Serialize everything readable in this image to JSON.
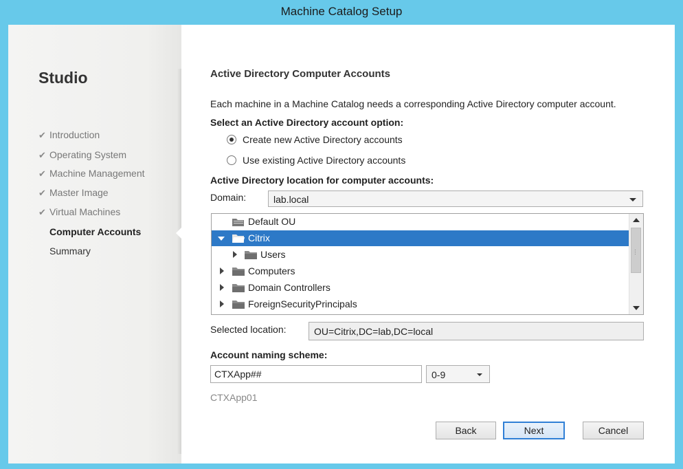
{
  "window": {
    "title": "Machine Catalog Setup"
  },
  "sidebar": {
    "app_name": "Studio",
    "steps": [
      {
        "label": "Introduction",
        "state": "done"
      },
      {
        "label": "Operating System",
        "state": "done"
      },
      {
        "label": "Machine Management",
        "state": "done"
      },
      {
        "label": "Master Image",
        "state": "done"
      },
      {
        "label": "Virtual Machines",
        "state": "done"
      },
      {
        "label": "Computer Accounts",
        "state": "current"
      },
      {
        "label": "Summary",
        "state": "pending"
      }
    ]
  },
  "main": {
    "heading": "Active Directory Computer Accounts",
    "intro": "Each machine in a Machine Catalog needs a corresponding Active Directory computer account.",
    "option_label": "Select an Active Directory account option:",
    "options": [
      {
        "label": "Create new Active Directory accounts",
        "selected": true
      },
      {
        "label": "Use existing Active Directory accounts",
        "selected": false
      }
    ],
    "location_label": "Active Directory location for computer accounts:",
    "domain": {
      "label": "Domain:",
      "value": "lab.local"
    },
    "tree": [
      {
        "name": "Default OU",
        "expander": "none",
        "selected": false
      },
      {
        "name": "Citrix",
        "expander": "open",
        "selected": true
      },
      {
        "name": "Users",
        "expander": "closed",
        "selected": false
      },
      {
        "name": "Computers",
        "expander": "closed",
        "selected": false
      },
      {
        "name": "Domain Controllers",
        "expander": "closed",
        "selected": false
      },
      {
        "name": "ForeignSecurityPrincipals",
        "expander": "closed",
        "selected": false
      }
    ],
    "selected_location": {
      "label": "Selected location:",
      "value": "OU=Citrix,DC=lab,DC=local"
    },
    "naming": {
      "label": "Account naming scheme:",
      "value": "CTXApp##",
      "scheme": "0-9",
      "preview": "CTXApp01"
    }
  },
  "buttons": {
    "back": "Back",
    "next": "Next",
    "cancel": "Cancel"
  },
  "colors": {
    "title_bar": "#67c9ea",
    "selection": "#2d79c7",
    "default_button_border": "#2f7fd6"
  },
  "icons": {
    "checkmark": "checkmark-icon",
    "folder": "folder-icon",
    "default_ou": "ou-icon"
  }
}
